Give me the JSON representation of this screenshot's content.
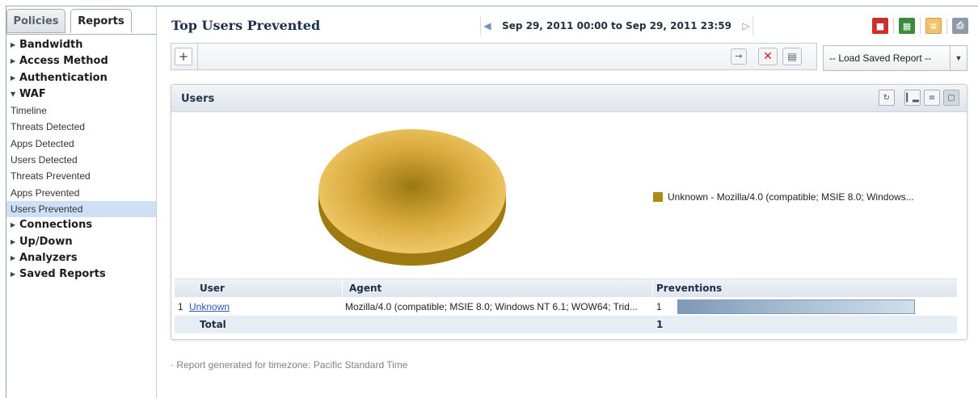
{
  "sidebar": {
    "tabs": [
      "Policies",
      "Reports"
    ],
    "items": [
      {
        "label": "Bandwidth",
        "type": "category",
        "expanded": false
      },
      {
        "label": "Access Method",
        "type": "category",
        "expanded": false
      },
      {
        "label": "Authentication",
        "type": "category",
        "expanded": false
      },
      {
        "label": "WAF",
        "type": "category",
        "expanded": true
      },
      {
        "label": "Timeline",
        "type": "sub"
      },
      {
        "label": "Threats Detected",
        "type": "sub"
      },
      {
        "label": "Apps Detected",
        "type": "sub"
      },
      {
        "label": "Users Detected",
        "type": "sub"
      },
      {
        "label": "Threats Prevented",
        "type": "sub"
      },
      {
        "label": "Apps Prevented",
        "type": "sub"
      },
      {
        "label": "Users Prevented",
        "type": "sub",
        "selected": true
      },
      {
        "label": "Connections",
        "type": "category",
        "expanded": false
      },
      {
        "label": "Up/Down",
        "type": "category",
        "expanded": false
      },
      {
        "label": "Analyzers",
        "type": "category",
        "expanded": false
      },
      {
        "label": "Saved Reports",
        "type": "category",
        "expanded": false
      }
    ]
  },
  "header": {
    "title": "Top Users Prevented",
    "date_range": "Sep 29, 2011 00:00 to Sep 29, 2011 23:59",
    "export_icons": [
      "pdf-icon",
      "excel-icon",
      "notes-icon",
      "print-icon"
    ]
  },
  "filter": {
    "add_label": "+",
    "load_saved_report": "-- Load Saved Report --"
  },
  "panel": {
    "title": "Users",
    "view_icons": [
      "refresh-icon",
      "bar-chart-view-icon",
      "list-view-icon",
      "pie-chart-view-icon"
    ]
  },
  "chart_data": {
    "type": "pie",
    "slices": [
      {
        "label": "Unknown - Mozilla/4.0 (compatible; MSIE 8.0; Windows...",
        "value": 1,
        "color": "#b08a17"
      }
    ]
  },
  "table": {
    "headers": [
      "User",
      "Agent",
      "Preventions"
    ],
    "rows": [
      {
        "rank": "1",
        "user": "Unknown",
        "agent": "Mozilla/4.0 (compatible; MSIE 8.0; Windows NT 6.1; WOW64; Trid...",
        "preventions": "1",
        "bar_fraction": 1.0
      }
    ],
    "total_label": "Total",
    "total_value": "1"
  },
  "footnote": "· Report generated for timezone: Pacific Standard Time",
  "colors": {
    "pie": "#e8bb4d",
    "pie_dark": "#a88412",
    "selected_nav": "#cde0f6",
    "link": "#2a56a8"
  }
}
